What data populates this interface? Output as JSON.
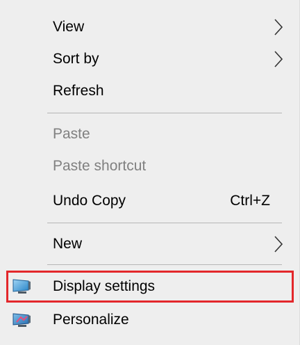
{
  "context_menu": {
    "items": [
      {
        "label": "View",
        "submenu": true
      },
      {
        "label": "Sort by",
        "submenu": true
      },
      {
        "label": "Refresh"
      },
      {
        "label": "Paste",
        "disabled": true
      },
      {
        "label": "Paste shortcut",
        "disabled": true
      },
      {
        "label": "Undo Copy",
        "shortcut": "Ctrl+Z"
      },
      {
        "label": "New",
        "submenu": true
      },
      {
        "label": "Display settings",
        "icon": "display-settings-icon",
        "highlighted": true
      },
      {
        "label": "Personalize",
        "icon": "personalize-icon"
      }
    ]
  },
  "colors": {
    "menu_background": "#eeeeee",
    "disabled_text": "#808080",
    "separator": "#b5b5b5",
    "highlight_border": "#e3272b"
  }
}
